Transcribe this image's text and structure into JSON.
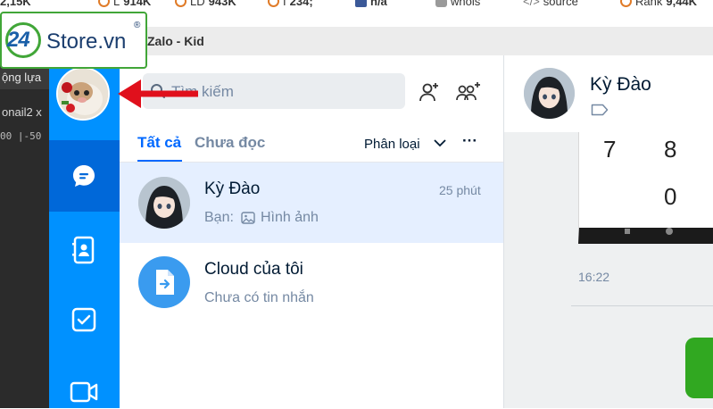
{
  "browser_stats": [
    {
      "label": "",
      "value": "2,15K",
      "icon": "orange-circle-icon"
    },
    {
      "label": "L",
      "value": "914K",
      "icon": "orange-circle-icon"
    },
    {
      "label": "LD",
      "value": "943K",
      "icon": "orange-circle-icon"
    },
    {
      "label": "I",
      "value": "234;",
      "icon": "orange-circle-icon"
    },
    {
      "label": "",
      "value": "n/a",
      "icon": "facebook-icon"
    },
    {
      "label": "whois",
      "value": "",
      "icon": "person-icon"
    },
    {
      "label": "source",
      "value": "",
      "icon": "code-icon"
    },
    {
      "label": "Rank",
      "value": "9,44K",
      "icon": "orange-circle-icon"
    }
  ],
  "background_window": {
    "row1": "ộng lựa",
    "row2": "onail2 x",
    "row3": "00  |-50"
  },
  "window": {
    "title": "Zalo - Kid"
  },
  "logo": {
    "number": "24",
    "text": "Store.vn",
    "mark": "®"
  },
  "sidebar": {
    "items": [
      {
        "name": "chat",
        "icon": "chat-bubble-icon"
      },
      {
        "name": "contacts",
        "icon": "contacts-icon"
      },
      {
        "name": "todo",
        "icon": "checkbox-icon"
      },
      {
        "name": "video",
        "icon": "video-icon"
      }
    ]
  },
  "search": {
    "placeholder": "Tìm kiếm"
  },
  "tabs": {
    "all": "Tất cả",
    "unread": "Chưa đọc",
    "filter": "Phân loại",
    "more": "···"
  },
  "conversations": [
    {
      "name": "Kỳ Đào",
      "time": "25 phút",
      "sender": "Bạn:",
      "preview": "Hình ảnh"
    },
    {
      "name": "Cloud của tôi",
      "time": "",
      "sender": "",
      "preview": "Chưa có tin nhắn"
    }
  ],
  "chat": {
    "contact_name": "Kỳ Đào",
    "keypad": [
      "7",
      "8",
      "0"
    ],
    "message_time": "16:22"
  },
  "colors": {
    "sidebar": "#0091ff",
    "sidebar_active": "#0068d9",
    "accent": "#0068ff",
    "selected_row": "#e5efff",
    "logo_green": "#41a638",
    "arrow": "#e0101c"
  }
}
